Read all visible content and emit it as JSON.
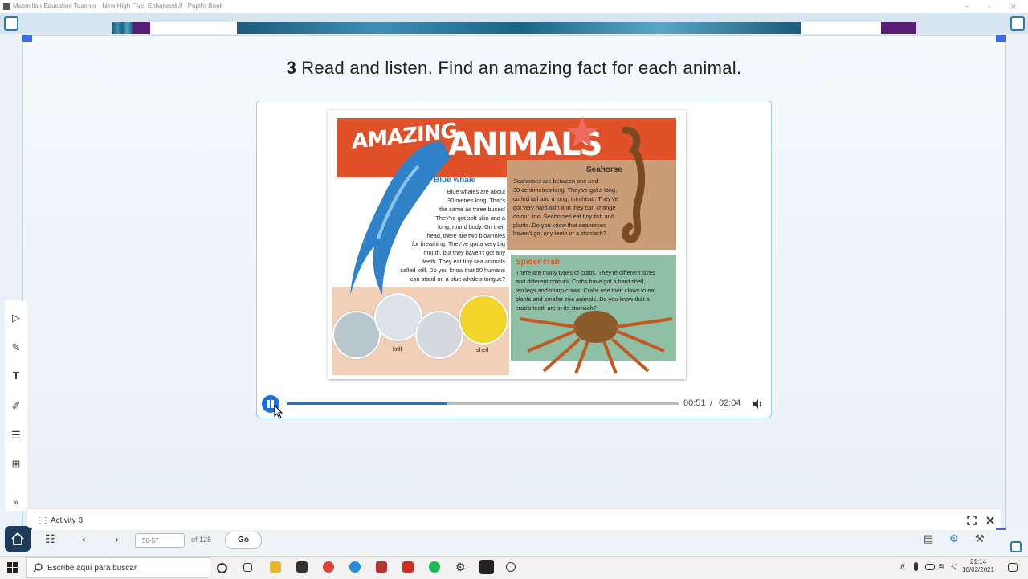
{
  "window": {
    "title": "Macmillan Education Teacher - New High Five! Enhanced 3 - Pupil's Book"
  },
  "activity": {
    "number": "3",
    "instruction": "Read and listen. Find an amazing fact for each animal.",
    "bar_label": "Activity 3"
  },
  "book_page": {
    "title_top": "AMAZING",
    "title_main": "ANIMALS",
    "whale": {
      "heading": "Blue whale",
      "lines": [
        "Blue whales are about",
        "30 metres long. That's",
        "the same as three buses!",
        "They've got soft skin and a",
        "long, round body. On their",
        "head, there are two blowholes",
        "for breathing. They've got a very big",
        "mouth, but they haven't got any",
        "teeth. They eat tiny sea animals",
        "called krill. Do you know that 50 humans",
        "can stand on a blue whale's tongue?"
      ]
    },
    "seahorse": {
      "heading": "Seahorse",
      "lines": [
        "Seahorses are between one and",
        "30 centimetres long. They've got a long,",
        "curled tail and a long, thin head. They've",
        "got very hard skin and they can change",
        "colour, too. Seahorses eat tiny fish and",
        "plants. Do you know that seahorses",
        "haven't got any teeth or a stomach?"
      ]
    },
    "crab": {
      "heading": "Spider crab",
      "lines": [
        "There are many types of crabs. They're different sizes",
        "and different colours. Crabs have got a hard shell,",
        "ten legs and sharp claws. Crabs use their claws to eat",
        "plants and smaller sea animals. Do you know that a",
        "crab's teeth are in its stomach?"
      ]
    },
    "labels": {
      "krill": "krill",
      "shell": "shell"
    }
  },
  "audio": {
    "current": "00:51",
    "separator": "/",
    "total": "02:04",
    "progress": 0.41
  },
  "navigation": {
    "page_value": "56-57",
    "of_pages": "of 128",
    "go": "Go"
  },
  "taskbar": {
    "search_placeholder": "Escribe aquí para buscar",
    "time": "21:14",
    "date": "10/02/2021"
  },
  "colors": {
    "accent": "#3a6cf0",
    "play": "#1e6fd9",
    "banner": "#e0512a"
  }
}
